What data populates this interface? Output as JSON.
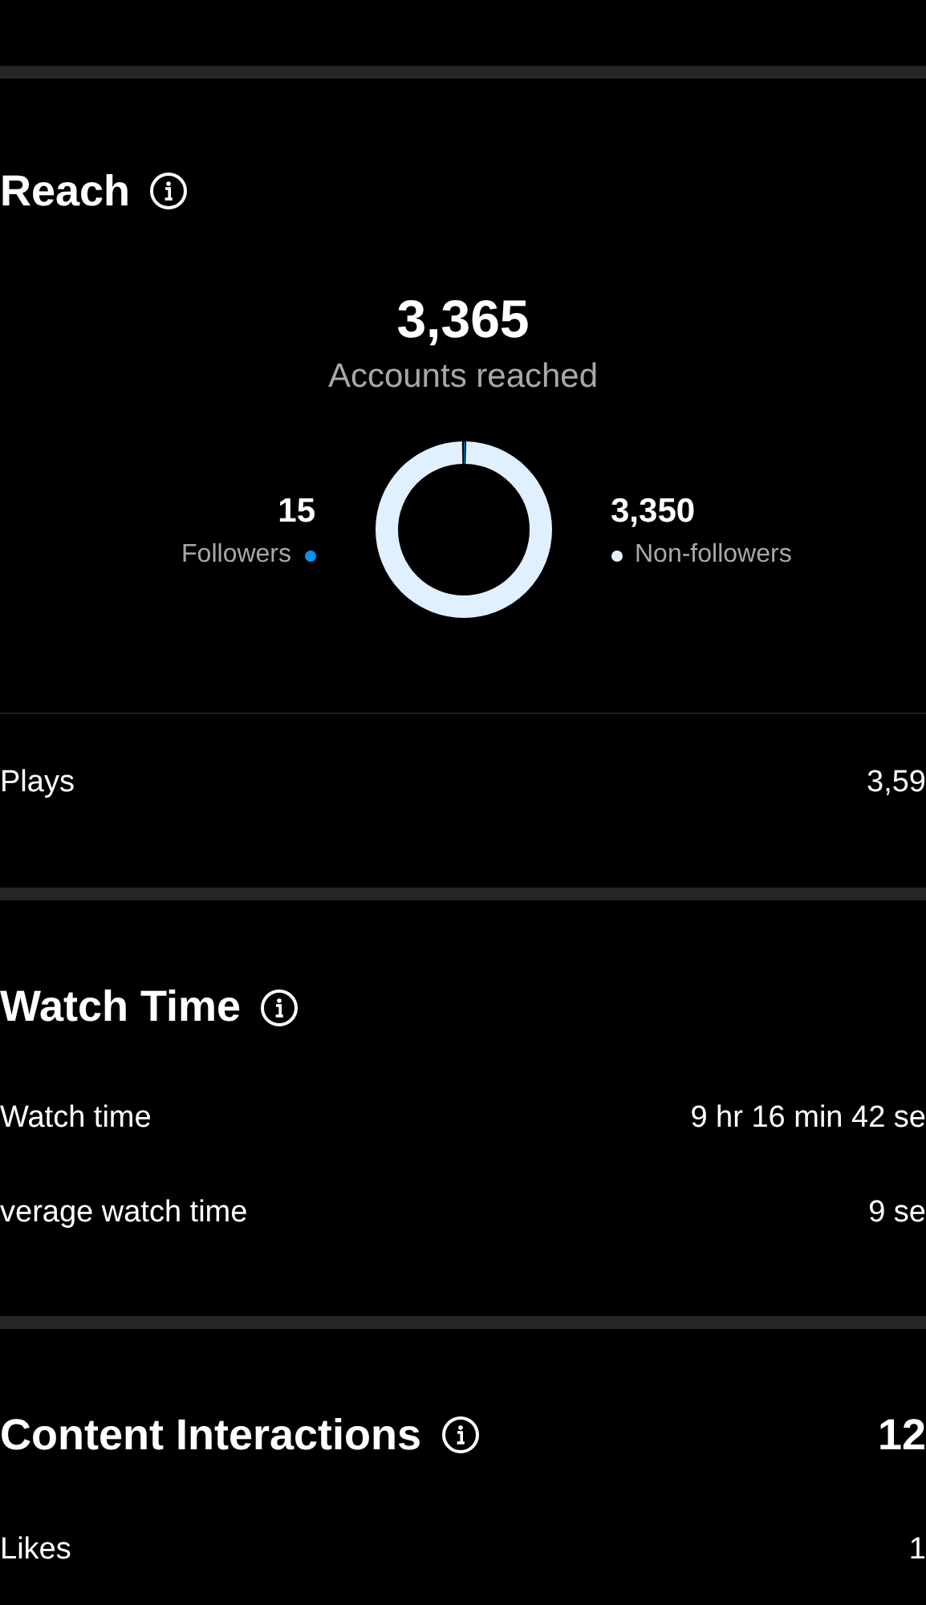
{
  "reach": {
    "title": "Reach",
    "total": "3,365",
    "total_label": "Accounts reached",
    "followers": {
      "value": "15",
      "label": "Followers",
      "color": "#0095f6"
    },
    "non_followers": {
      "value": "3,350",
      "label": "Non-followers",
      "color": "#e0f0ff"
    },
    "rows": [
      {
        "label": "Plays",
        "value": "3,59"
      }
    ]
  },
  "watch_time": {
    "title": "Watch Time",
    "rows": [
      {
        "label": "Watch time",
        "value": "9 hr 16 min 42 se"
      },
      {
        "label": "verage watch time",
        "value": "9 se"
      }
    ]
  },
  "content_interactions": {
    "title": "Content Interactions",
    "total": "12",
    "rows": [
      {
        "label": "Likes",
        "value": "1"
      }
    ]
  }
}
